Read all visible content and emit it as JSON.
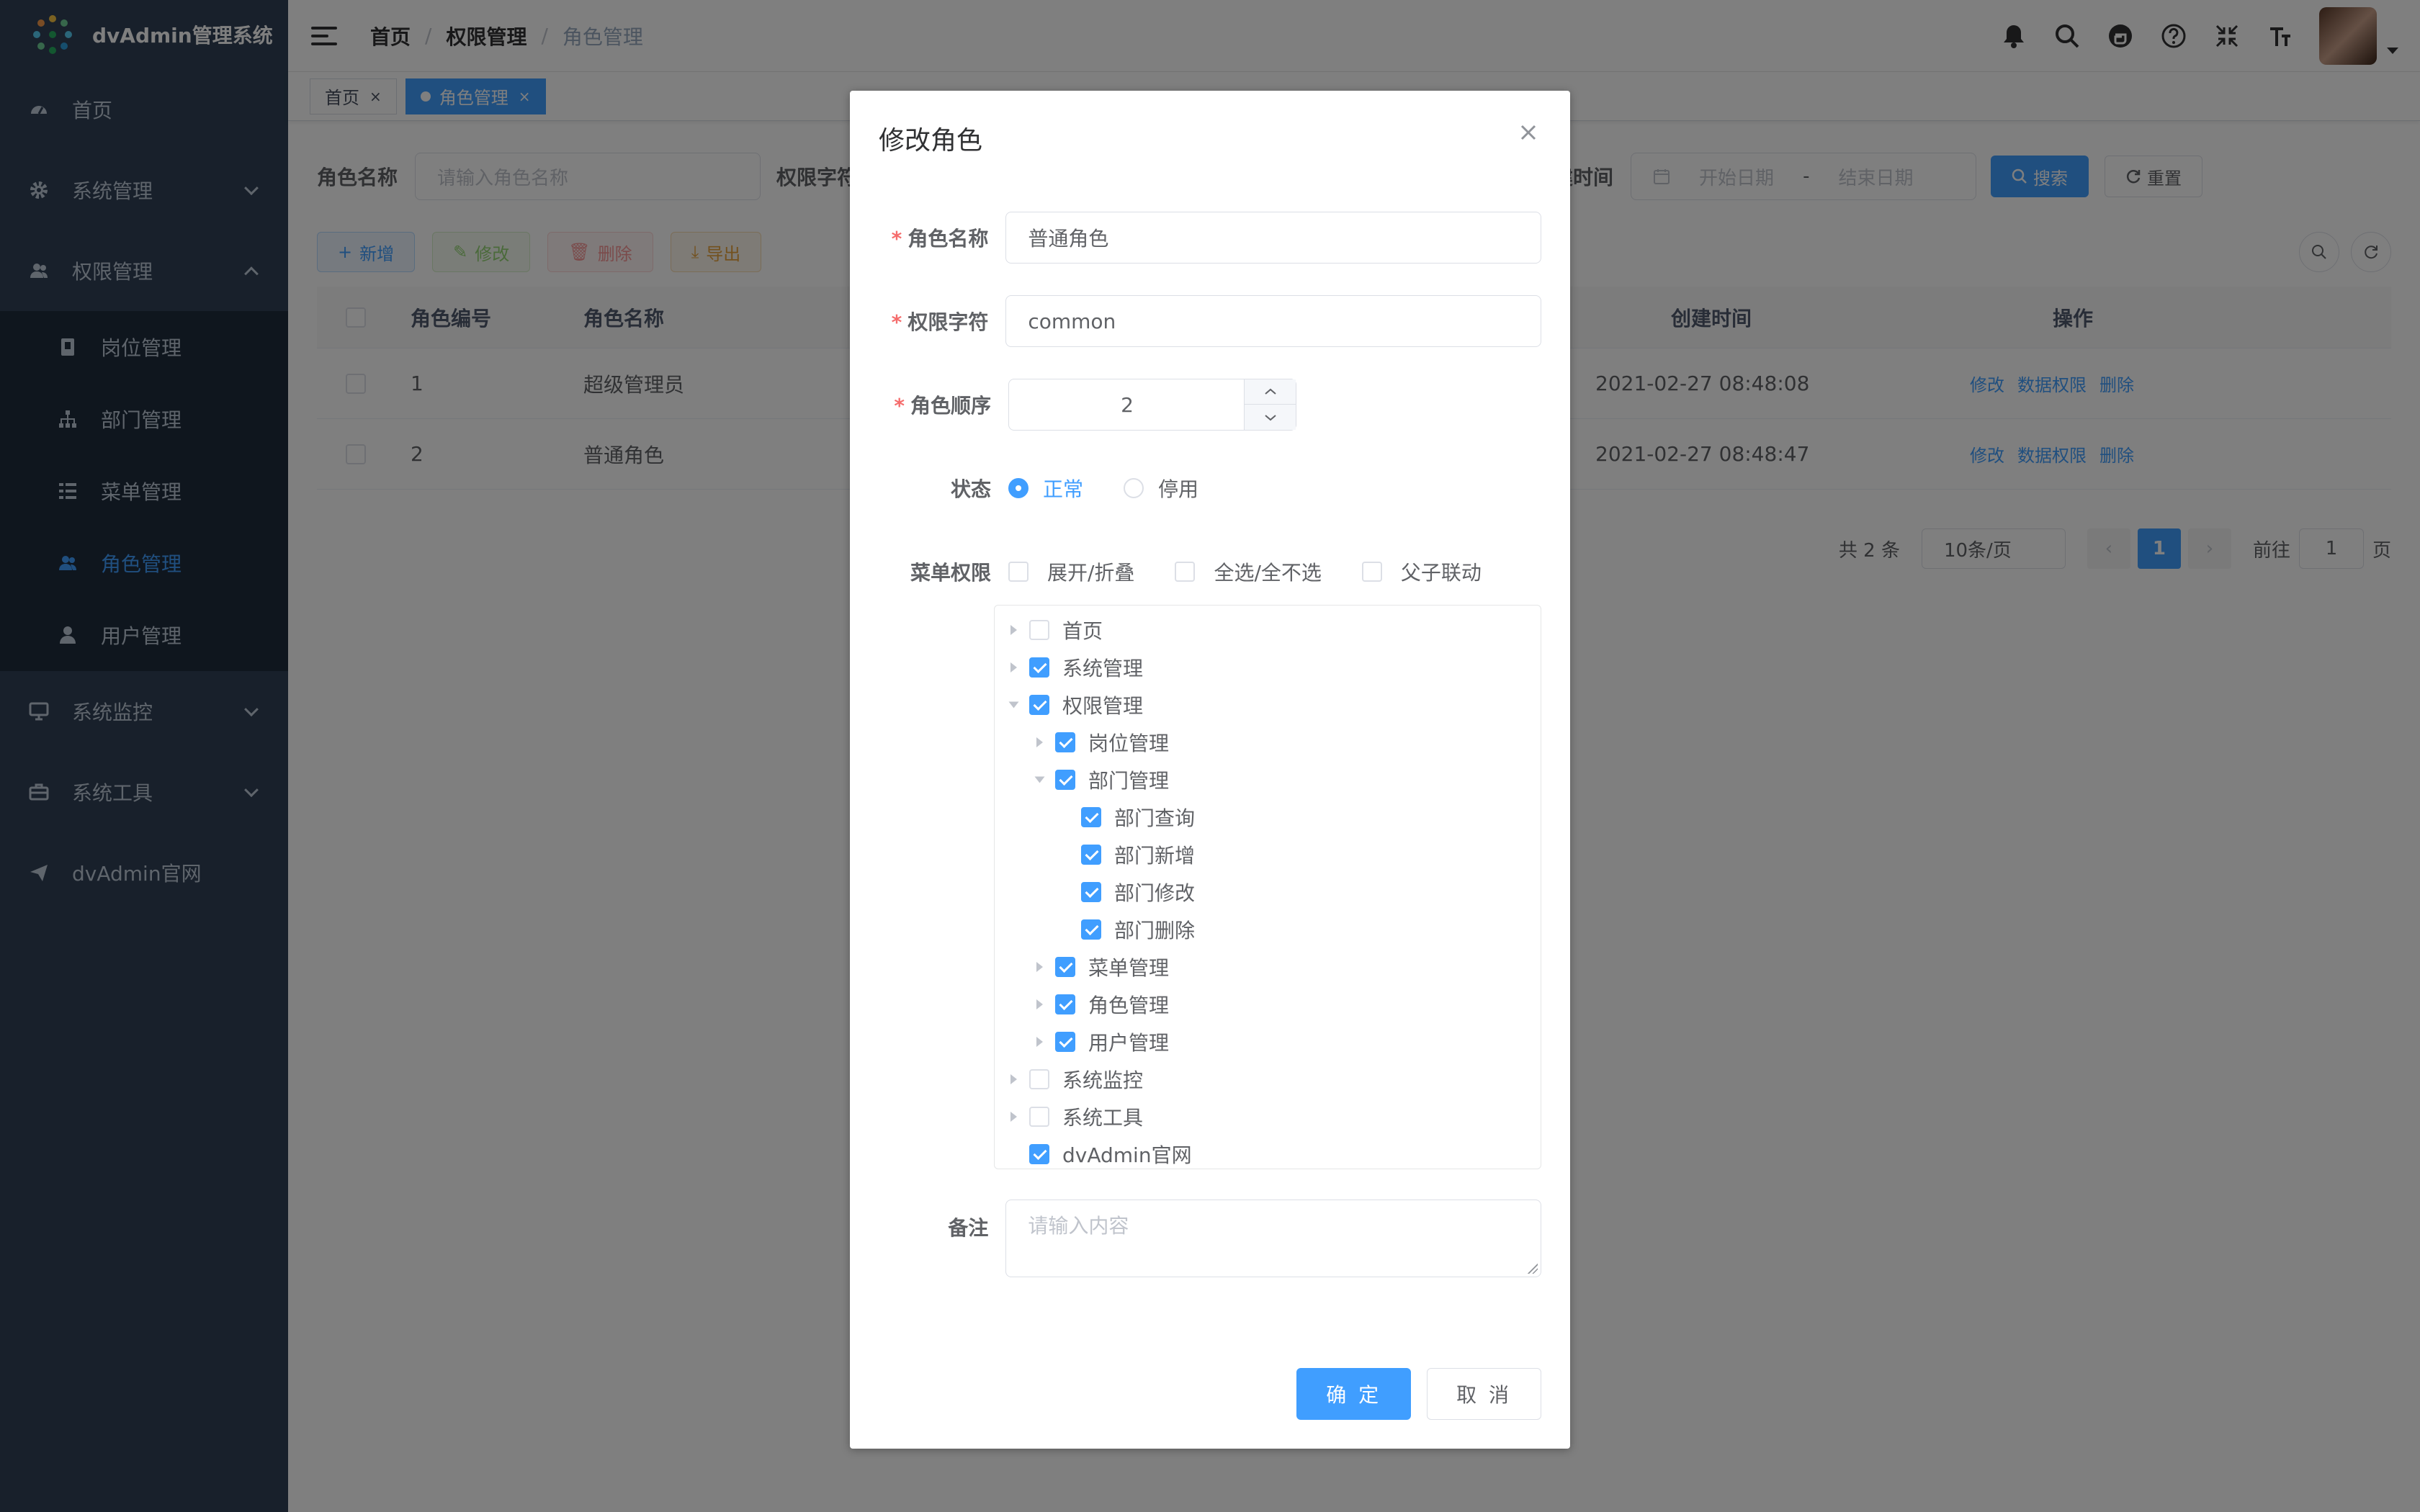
{
  "app": {
    "title": "dvAdmin管理系统"
  },
  "sidebar": {
    "items": [
      {
        "label": "首页",
        "icon": "dashboard-icon"
      },
      {
        "label": "系统管理",
        "icon": "gear-icon"
      },
      {
        "label": "权限管理",
        "icon": "users-icon",
        "expanded": true
      },
      {
        "label": "系统监控",
        "icon": "monitor-icon"
      },
      {
        "label": "系统工具",
        "icon": "toolbox-icon"
      },
      {
        "label": "dvAdmin官网",
        "icon": "send-icon"
      }
    ],
    "sub_items": [
      {
        "label": "岗位管理",
        "icon": "badge-icon"
      },
      {
        "label": "部门管理",
        "icon": "org-tree-icon"
      },
      {
        "label": "菜单管理",
        "icon": "list-icon"
      },
      {
        "label": "角色管理",
        "icon": "user-group-icon",
        "active": true
      },
      {
        "label": "用户管理",
        "icon": "user-icon"
      }
    ]
  },
  "breadcrumb": [
    "首页",
    "权限管理",
    "角色管理"
  ],
  "tags": [
    {
      "label": "首页",
      "active": false
    },
    {
      "label": "角色管理",
      "active": true
    }
  ],
  "search": {
    "role_name_label": "角色名称",
    "role_name_placeholder": "请输入角色名称",
    "perm_label": "权限字符",
    "created_label": "创建时间",
    "start_placeholder": "开始日期",
    "range_sep": "-",
    "end_placeholder": "结束日期",
    "search_button": "搜索",
    "reset_button": "重置"
  },
  "ops": {
    "add": "新增",
    "edit": "修改",
    "delete": "删除",
    "export": "导出"
  },
  "table": {
    "headers": {
      "id": "角色编号",
      "name": "角色名称",
      "created": "创建时间",
      "action": "操作"
    },
    "rows": [
      {
        "id": "1",
        "name": "超级管理员",
        "created": "2021-02-27 08:48:08"
      },
      {
        "id": "2",
        "name": "普通角色",
        "created": "2021-02-27 08:48:47"
      }
    ],
    "actions": {
      "edit": "修改",
      "data_perm": "数据权限",
      "delete": "删除"
    }
  },
  "pager": {
    "total": "共 2 条",
    "size": "10条/页",
    "page": "1",
    "goto_label": "前往",
    "goto_value": "1",
    "goto_suffix": "页"
  },
  "dialog": {
    "title": "修改角色",
    "role_name_label": "角色名称",
    "role_name_value": "普通角色",
    "perm_label": "权限字符",
    "perm_value": "common",
    "order_label": "角色顺序",
    "order_value": "2",
    "status_label": "状态",
    "status_normal": "正常",
    "status_disabled": "停用",
    "menu_perm_label": "菜单权限",
    "expand_label": "展开/折叠",
    "select_all_label": "全选/全不选",
    "linkage_label": "父子联动",
    "tree": [
      {
        "label": "首页",
        "level": 0,
        "checked": false,
        "caret": "closed"
      },
      {
        "label": "系统管理",
        "level": 0,
        "checked": true,
        "caret": "closed"
      },
      {
        "label": "权限管理",
        "level": 0,
        "checked": true,
        "caret": "open"
      },
      {
        "label": "岗位管理",
        "level": 1,
        "checked": true,
        "caret": "closed"
      },
      {
        "label": "部门管理",
        "level": 1,
        "checked": true,
        "caret": "open"
      },
      {
        "label": "部门查询",
        "level": 2,
        "checked": true,
        "caret": "none"
      },
      {
        "label": "部门新增",
        "level": 2,
        "checked": true,
        "caret": "none"
      },
      {
        "label": "部门修改",
        "level": 2,
        "checked": true,
        "caret": "none"
      },
      {
        "label": "部门删除",
        "level": 2,
        "checked": true,
        "caret": "none"
      },
      {
        "label": "菜单管理",
        "level": 1,
        "checked": true,
        "caret": "closed"
      },
      {
        "label": "角色管理",
        "level": 1,
        "checked": true,
        "caret": "closed"
      },
      {
        "label": "用户管理",
        "level": 1,
        "checked": true,
        "caret": "closed"
      },
      {
        "label": "系统监控",
        "level": 0,
        "checked": false,
        "caret": "closed"
      },
      {
        "label": "系统工具",
        "level": 0,
        "checked": false,
        "caret": "closed"
      },
      {
        "label": "dvAdmin官网",
        "level": 0,
        "checked": true,
        "caret": "none"
      }
    ],
    "remark_label": "备注",
    "remark_placeholder": "请输入内容",
    "confirm_button": "确 定",
    "cancel_button": "取 消"
  },
  "colors": {
    "primary": "#409eff",
    "sidebar": "#304156",
    "submenu": "#1f2d3d",
    "danger": "#f56c6c"
  }
}
